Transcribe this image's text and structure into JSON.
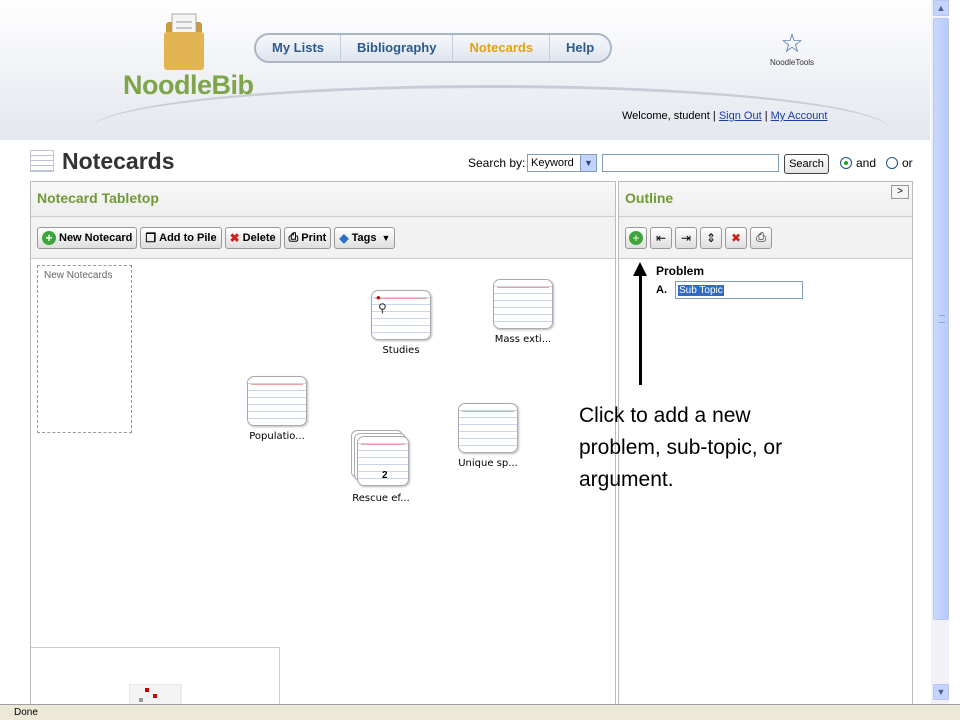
{
  "header": {
    "logo_text": "NoodleBib",
    "nav": [
      "My Lists",
      "Bibliography",
      "Notecards",
      "Help"
    ],
    "active_tab": "Notecards",
    "brand_right": "NoodleTools",
    "welcome": "Welcome, student",
    "sign_out": "Sign Out",
    "my_account": "My Account",
    "separator": "|"
  },
  "titlebar": {
    "title": "Notecards",
    "search_by_label": "Search by:",
    "search_select": "Keyword",
    "search_input": "",
    "search_button": "Search",
    "radio_and": "and",
    "radio_or": "or",
    "selected_radio": "and"
  },
  "tabletop": {
    "title": "Notecard Tabletop",
    "buttons": {
      "new": "New Notecard",
      "add_pile": "Add to Pile",
      "delete": "Delete",
      "print": "Print",
      "tags": "Tags"
    },
    "pile_label": "New Notecards",
    "cards": [
      "Studies",
      "Mass exti...",
      "Populatio...",
      "Unique sp...",
      "Rescue ef..."
    ],
    "pile_count": "2"
  },
  "outline": {
    "title": "Outline",
    "problem": "Problem",
    "item_a": "A.",
    "subtopic_value": "Sub Topic"
  },
  "annotation": "Click to add a new problem, sub-topic, or argument.",
  "status": "Done",
  "colors": {
    "brand_green": "#6e9b37",
    "nav_blue": "#2d5a8c",
    "nav_active": "#e6a20e",
    "link": "#1a3ea8"
  }
}
